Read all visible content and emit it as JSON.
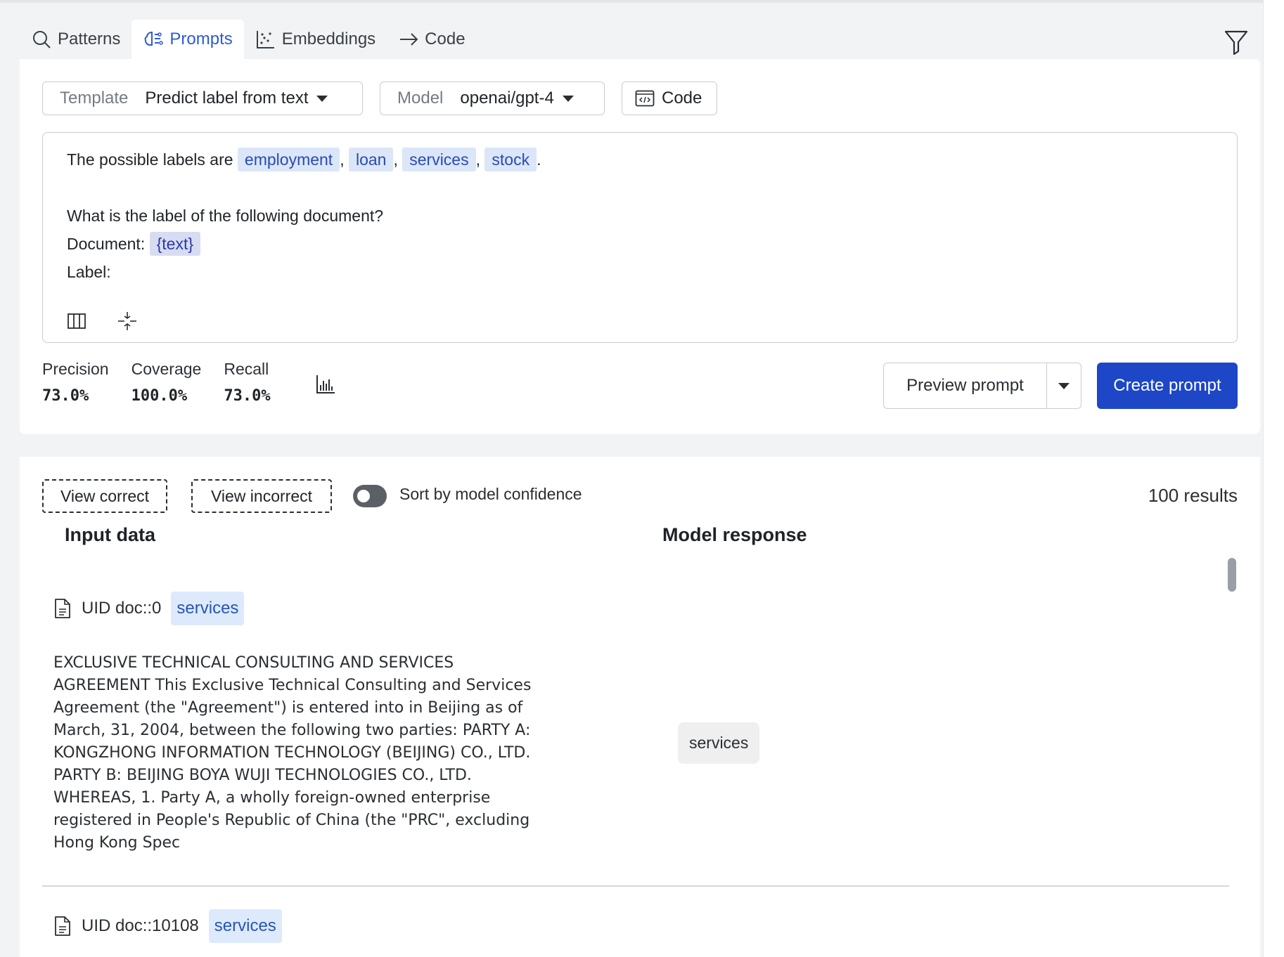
{
  "tabs": [
    {
      "label": "Patterns",
      "icon": "search-icon",
      "active": false
    },
    {
      "label": "Prompts",
      "icon": "brain-icon",
      "active": true
    },
    {
      "label": "Embeddings",
      "icon": "scatter-icon",
      "active": false
    },
    {
      "label": "Code",
      "icon": "arrow-right-icon",
      "active": false
    }
  ],
  "toolbar": {
    "template_label": "Template",
    "template_value": "Predict label from text",
    "model_label": "Model",
    "model_value": "openai/gpt-4",
    "code_label": "Code"
  },
  "prompt": {
    "line1_prefix": "The possible labels are",
    "labels": [
      "employment",
      "loan",
      "services",
      "stock"
    ],
    "line1_suffix": ".",
    "line3": "What is the label of the following document?",
    "doc_prefix": "Document:",
    "doc_var": "{text}",
    "label_line": "Label:"
  },
  "metrics": [
    {
      "label": "Precision",
      "value": "73.0%"
    },
    {
      "label": "Coverage",
      "value": "100.0%"
    },
    {
      "label": "Recall",
      "value": "73.0%"
    }
  ],
  "actions": {
    "preview_label": "Preview prompt",
    "create_label": "Create prompt"
  },
  "results": {
    "view_correct": "View correct",
    "view_incorrect": "View incorrect",
    "sort_label": "Sort by model confidence",
    "sort_enabled": false,
    "count": "100 results",
    "col_input": "Input data",
    "col_response": "Model response",
    "rows": [
      {
        "uid": "UID doc::0",
        "label": "services",
        "text": "EXCLUSIVE TECHNICAL CONSULTING AND SERVICES\nAGREEMENT This Exclusive Technical Consulting and Services\nAgreement (the \"Agreement\") is entered into in Beijing as of\nMarch, 31, 2004, between the following two parties: PARTY A:\nKONGZHONG INFORMATION TECHNOLOGY (BEIJING) CO., LTD.\nPARTY B: BEIJING BOYA WUJI TECHNOLOGIES CO., LTD.\nWHEREAS, 1. Party A, a wholly foreign-owned enterprise\nregistered in People's Republic of China (the \"PRC\", excluding\nHong Kong Spec",
        "response": "services"
      },
      {
        "uid": "UID doc::10108",
        "label": "services"
      }
    ]
  }
}
